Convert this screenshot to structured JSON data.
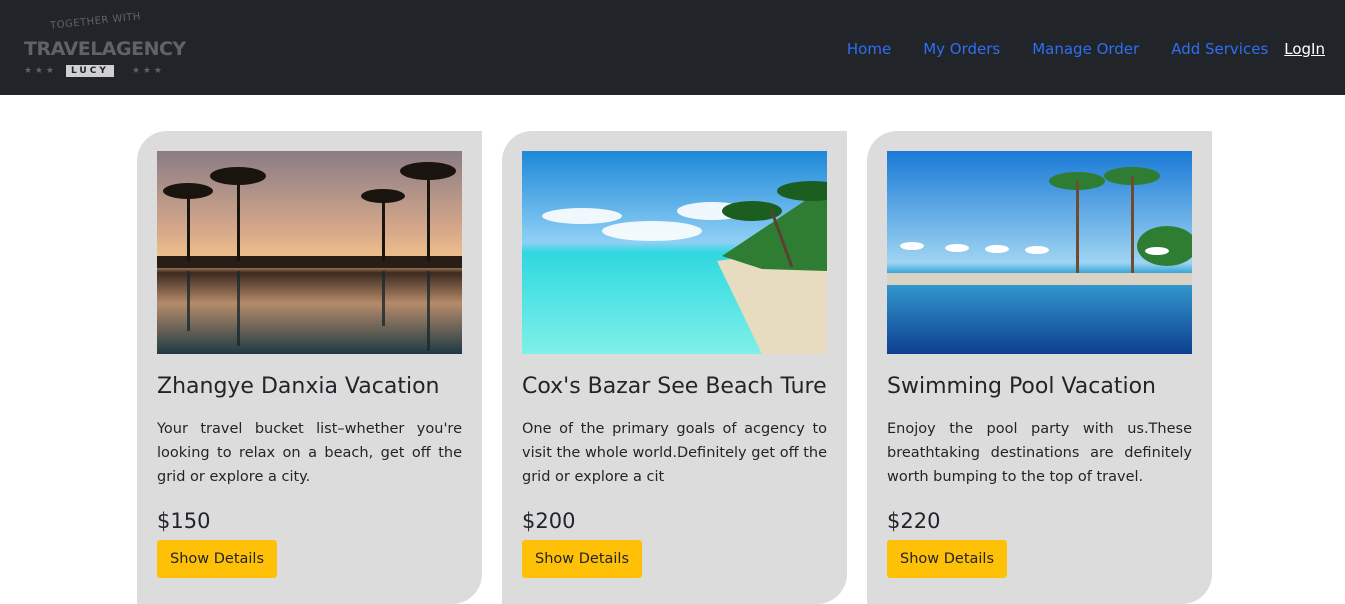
{
  "brand": {
    "tagline": "TOGETHER WITH",
    "name": "TRAVELAGENCY",
    "sub": "LUCY",
    "stars": "★ ★ ★"
  },
  "nav": {
    "home": "Home",
    "my_orders": "My Orders",
    "manage_order": "Manage Order",
    "add_services": "Add Services",
    "login": "LogIn"
  },
  "cards": [
    {
      "title": "Zhangye Danxia Vacation",
      "text": "Your travel bucket list–whether you're looking to relax on a beach, get off the grid or explore a city.",
      "price": "$150",
      "button": "Show Details"
    },
    {
      "title": "Cox's Bazar See Beach Ture",
      "text": "One of the primary goals of acgency to visit the whole world.Definitely get off the grid or explore a cit",
      "price": "$200",
      "button": "Show Details"
    },
    {
      "title": "Swimming Pool Vacation",
      "text": "Enojoy the pool party with us.These breathtaking destinations are definitely worth bumping to the top of travel.",
      "price": "$220",
      "button": "Show Details"
    }
  ]
}
